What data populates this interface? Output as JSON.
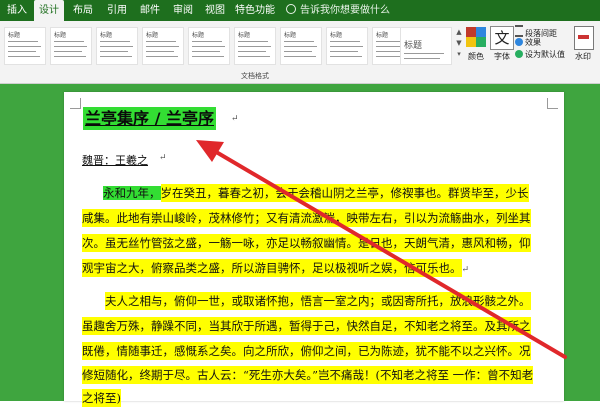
{
  "ribbon": {
    "tabs": [
      {
        "label": "插入",
        "active": false
      },
      {
        "label": "设计",
        "active": true
      },
      {
        "label": "布局",
        "active": false
      },
      {
        "label": "引用",
        "active": false
      },
      {
        "label": "邮件",
        "active": false
      },
      {
        "label": "审阅",
        "active": false
      },
      {
        "label": "视图",
        "active": false
      },
      {
        "label": "特色功能",
        "active": false
      }
    ],
    "tell_me": "告诉我你想要做什么",
    "style_card_caption": "标题",
    "big_card_caption": "标题",
    "group_label": "文档格式",
    "colors_label": "颜色",
    "fonts_label": "字体",
    "fonts_glyph": "文",
    "paragraph_spacing": "段落间距",
    "effects": "效果",
    "set_default": "设为默认值",
    "watermark": "水印",
    "colors": {
      "tab_bar": "#1e6f1e",
      "canvas": "#3fa53f",
      "highlight_yellow": "#ffff00",
      "highlight_green": "#33dd33",
      "arrow": "#e0282b"
    }
  },
  "document": {
    "title": "兰亭集序 / 兰亭序",
    "author": "魏晋：王羲之",
    "lines": [
      {
        "highlight_green": "永和九年，",
        "text": "岁在癸丑，暮春之初，会于会稽山阴之兰亭，修禊事也。群贤毕至，少长"
      },
      {
        "text": "咸集。此地有崇山峻岭，茂林修竹；又有清流激湍，映带左右，引以为流觞曲水，列坐其"
      },
      {
        "text": "次。虽无丝竹管弦之盛，一觞一咏，亦足以畅叙幽情。是日也，天朗气清，惠风和畅，仰"
      },
      {
        "text": "观宇宙之大，俯察品类之盛，所以游目骋怀，足以极视听之娱，信可乐也。"
      },
      {
        "text": "夫人之相与，俯仰一世，或取诸怀抱，悟言一室之内；或因寄所托，放浪形骸之外。"
      },
      {
        "text": "虽趣舍万殊，静躁不同，当其欣于所遇，暂得于己，快然自足，不知老之将至。及其所之"
      },
      {
        "text": "既倦，情随事迁，感慨系之矣。向之所欣，俯仰之间，已为陈迹，犹不能不以之兴怀。况"
      },
      {
        "text": "修短随化，终期于尽。古人云：“死生亦大矣。”岂不痛哉！(不知老之将至 一作：曾不知老"
      },
      {
        "text": "之将至)"
      }
    ]
  }
}
